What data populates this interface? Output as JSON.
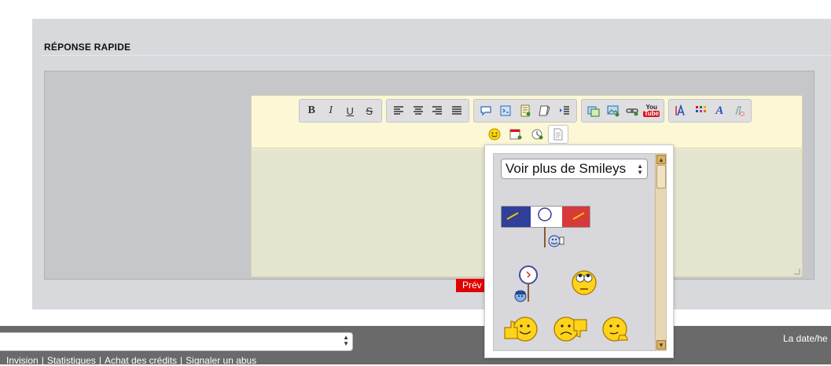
{
  "panel": {
    "title": "RÉPONSE RAPIDE"
  },
  "toolbar": {
    "bold_label": "B",
    "italic_label": "I",
    "underline_label": "U",
    "strike_label": "S",
    "icons_row1": [
      "bold-icon",
      "italic-icon",
      "underline-icon",
      "strike-icon",
      "align-left-icon",
      "align-center-icon",
      "align-right-icon",
      "align-justify-icon",
      "quote-icon",
      "code-icon",
      "spoiler-icon",
      "hide-icon",
      "indent-icon",
      "image-icon",
      "host-image-icon",
      "link-icon",
      "youtube-icon",
      "font-size-icon",
      "color-icon",
      "font-face-icon",
      "clear-format-icon"
    ],
    "youtube_top": "You",
    "youtube_bottom": "Tube",
    "icons_row2": [
      "smiley-icon",
      "calendar-icon",
      "clock-icon",
      "document-icon"
    ]
  },
  "smileys": {
    "select_value": "Voir plus de Smileys",
    "items": [
      "banner-smiley",
      "sign-smiley",
      "eyes-roll-smiley",
      "thumbs-up-smiley",
      "thumbs-down-smiley",
      "thinking-smiley"
    ]
  },
  "preview_button": "Prév",
  "footer": {
    "date_text": "La date/he",
    "links": [
      "Invision",
      "Statistiques",
      "Achat des crédits",
      "Signaler un abus"
    ],
    "separator": "|"
  },
  "colors": {
    "accent": "#e10000",
    "toolbar_bg": "#fcf7d5",
    "textarea_bg": "#e5e5cf",
    "footer_bg": "#6a6a6a"
  }
}
